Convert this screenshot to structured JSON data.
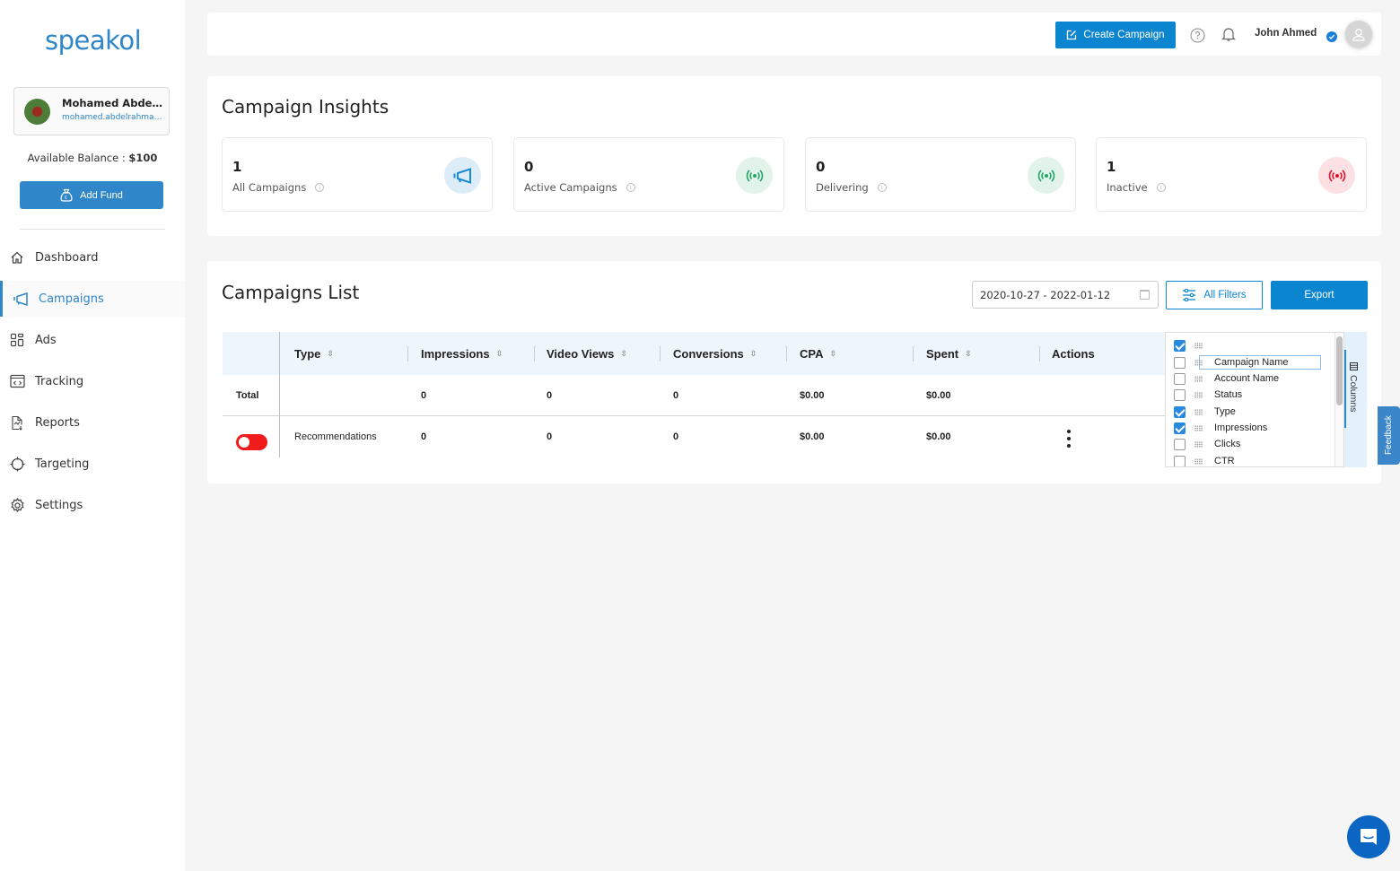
{
  "brand": {
    "logo_text": "speakol",
    "color": "#2f86c8"
  },
  "sidebar": {
    "profile": {
      "name": "Mohamed Abdelr...",
      "email": "mohamed.abdelrahman..."
    },
    "balance_label": "Available Balance :",
    "balance_value": "$100",
    "add_fund_label": "Add Fund",
    "items": [
      {
        "label": "Dashboard",
        "icon": "home-icon",
        "active": false
      },
      {
        "label": "Campaigns",
        "icon": "megaphone-icon",
        "active": true
      },
      {
        "label": "Ads",
        "icon": "grid-icon",
        "active": false
      },
      {
        "label": "Tracking",
        "icon": "code-window-icon",
        "active": false
      },
      {
        "label": "Reports",
        "icon": "report-icon",
        "active": false
      },
      {
        "label": "Targeting",
        "icon": "crosshair-icon",
        "active": false
      },
      {
        "label": "Settings",
        "icon": "gear-icon",
        "active": false
      }
    ]
  },
  "topbar": {
    "create_label": "Create Campaign",
    "user_name": "John Ahmed"
  },
  "insights": {
    "title": "Campaign Insights",
    "cards": [
      {
        "value": "1",
        "label": "All Campaigns",
        "icon": "megaphone-icon",
        "color": "#1a8ad4",
        "bg": "#dcedf8"
      },
      {
        "value": "0",
        "label": "Active Campaigns",
        "icon": "broadcast-icon",
        "color": "#23a566",
        "bg": "#e2f4ea"
      },
      {
        "value": "0",
        "label": "Delivering",
        "icon": "broadcast-icon",
        "color": "#23a566",
        "bg": "#e2f4ea"
      },
      {
        "value": "1",
        "label": "Inactive",
        "icon": "broadcast-icon",
        "color": "#e0122f",
        "bg": "#fbe0e4"
      }
    ]
  },
  "campaigns": {
    "title": "Campaigns List",
    "date_range": "2020-10-27 - 2022-01-12",
    "filters_label": "All Filters",
    "export_label": "Export",
    "columns": [
      "Type",
      "Impressions",
      "Video Views",
      "Conversions",
      "CPA",
      "Spent",
      "Actions"
    ],
    "total_row": {
      "label": "Total",
      "type": "",
      "impressions": "0",
      "video_views": "0",
      "conversions": "0",
      "cpa": "$0.00",
      "spent": "$0.00"
    },
    "rows": [
      {
        "active": false,
        "type": "Recommendations",
        "impressions": "0",
        "video_views": "0",
        "conversions": "0",
        "cpa": "$0.00",
        "spent": "$0.00"
      }
    ],
    "column_panel": {
      "tab_label": "Columns",
      "items": [
        {
          "label": "",
          "checked": true
        },
        {
          "label": "Campaign Name",
          "checked": false
        },
        {
          "label": "Account Name",
          "checked": false
        },
        {
          "label": "Status",
          "checked": false
        },
        {
          "label": "Type",
          "checked": true
        },
        {
          "label": "Impressions",
          "checked": true
        },
        {
          "label": "Clicks",
          "checked": false
        },
        {
          "label": "CTR",
          "checked": false
        }
      ]
    }
  },
  "feedback_label": "Feedback"
}
